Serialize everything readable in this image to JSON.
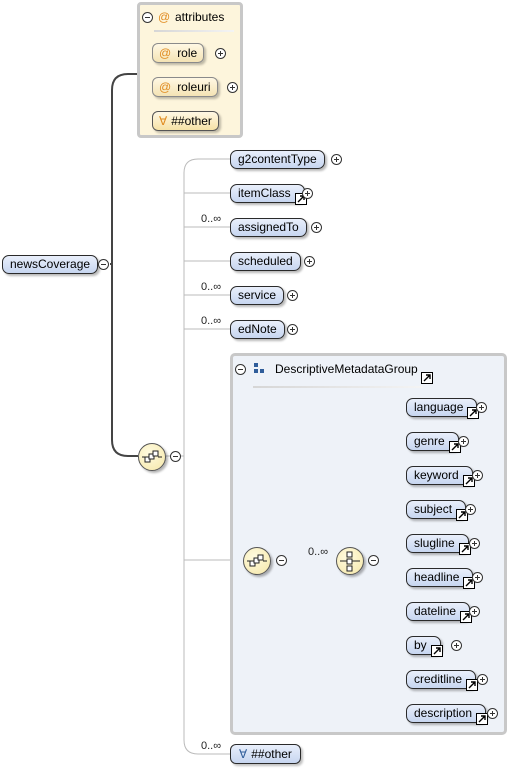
{
  "root": {
    "label": "newsCoverage"
  },
  "attributes": {
    "header": "attributes",
    "items": [
      {
        "label": "role"
      },
      {
        "label": "roleuri"
      }
    ],
    "other": "##other",
    "at_symbol": "@",
    "any_symbol": "∀"
  },
  "sequence": {
    "elements": [
      {
        "label": "g2contentType",
        "occurrence": ""
      },
      {
        "label": "itemClass",
        "occurrence": ""
      },
      {
        "label": "assignedTo",
        "occurrence": "0..∞"
      },
      {
        "label": "scheduled",
        "occurrence": ""
      },
      {
        "label": "service",
        "occurrence": "0..∞"
      },
      {
        "label": "edNote",
        "occurrence": "0..∞"
      }
    ],
    "other": {
      "label": "##other",
      "occurrence": "0..∞"
    }
  },
  "group": {
    "name": "DescriptiveMetadataGroup",
    "choice_occurrence": "0..∞",
    "elements": [
      {
        "label": "language"
      },
      {
        "label": "genre"
      },
      {
        "label": "keyword"
      },
      {
        "label": "subject"
      },
      {
        "label": "slugline"
      },
      {
        "label": "headline"
      },
      {
        "label": "dateline"
      },
      {
        "label": "by"
      },
      {
        "label": "creditline"
      },
      {
        "label": "description"
      }
    ]
  },
  "colors": {
    "node_fill": "#c7d6f0",
    "attribute_fill": "#fdf5dc",
    "compositor_fill": "#f5e7a8",
    "accent_icon": "#e08a1e"
  }
}
